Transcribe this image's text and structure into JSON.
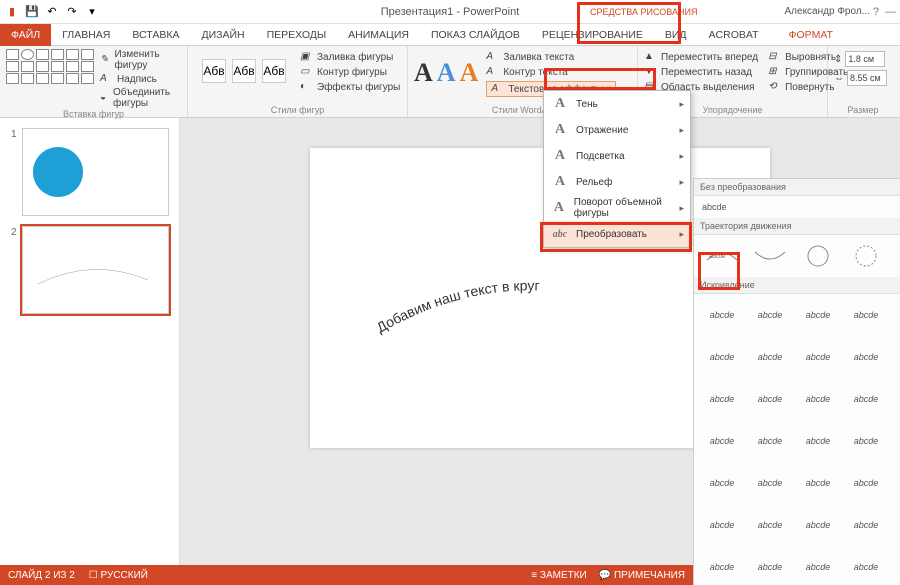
{
  "app": {
    "title": "Презентация1 - PowerPoint",
    "context_tab_group": "СРЕДСТВА РИСОВАНИЯ",
    "user": "Александр Фрол..."
  },
  "tabs": [
    "ФАЙЛ",
    "ГЛАВНАЯ",
    "ВСТАВКА",
    "ДИЗАЙН",
    "ПЕРЕХОДЫ",
    "АНИМАЦИЯ",
    "ПОКАЗ СЛАЙДОВ",
    "РЕЦЕНЗИРОВАНИЕ",
    "ВИД",
    "ACROBAT",
    "ФОРМАТ"
  ],
  "ribbon": {
    "groups": {
      "shapes": {
        "label": "Вставка фигур",
        "edit_shape": "Изменить фигуру",
        "text_box": "Надпись",
        "merge": "Объединить фигуры"
      },
      "styles": {
        "label": "Стили фигур",
        "fill": "Заливка фигуры",
        "outline": "Контур фигуры",
        "effects": "Эффекты фигуры"
      },
      "wordart": {
        "label": "Стили WordArt",
        "text_fill": "Заливка текста",
        "text_outline": "Контур текста",
        "text_effects": "Текстовые эффекты"
      },
      "arrange": {
        "label": "Упорядочение",
        "bring_fwd": "Переместить вперед",
        "send_back": "Переместить назад",
        "selection": "Область выделения",
        "align": "Выровнять",
        "group": "Группировать",
        "rotate": "Повернуть"
      },
      "size": {
        "label": "Размер",
        "h": "1.8 см",
        "w": "8.55 см"
      }
    }
  },
  "fx_menu": [
    "Тень",
    "Отражение",
    "Подсветка",
    "Рельеф",
    "Поворот объемной фигуры",
    "Преобразовать"
  ],
  "warp": {
    "none_hdr": "Без преобразования",
    "none_sample": "abcde",
    "path_hdr": "Траектория движения",
    "warp_hdr": "Искривление",
    "sample": "abcde"
  },
  "slide_text": "Добавим наш текст в круг",
  "status": {
    "slide": "СЛАЙД 2 ИЗ 2",
    "lang": "РУССКИЙ",
    "notes": "ЗАМЕТКИ",
    "comments": "ПРИМЕЧАНИЯ"
  },
  "thumb_nums": [
    "1",
    "2"
  ]
}
